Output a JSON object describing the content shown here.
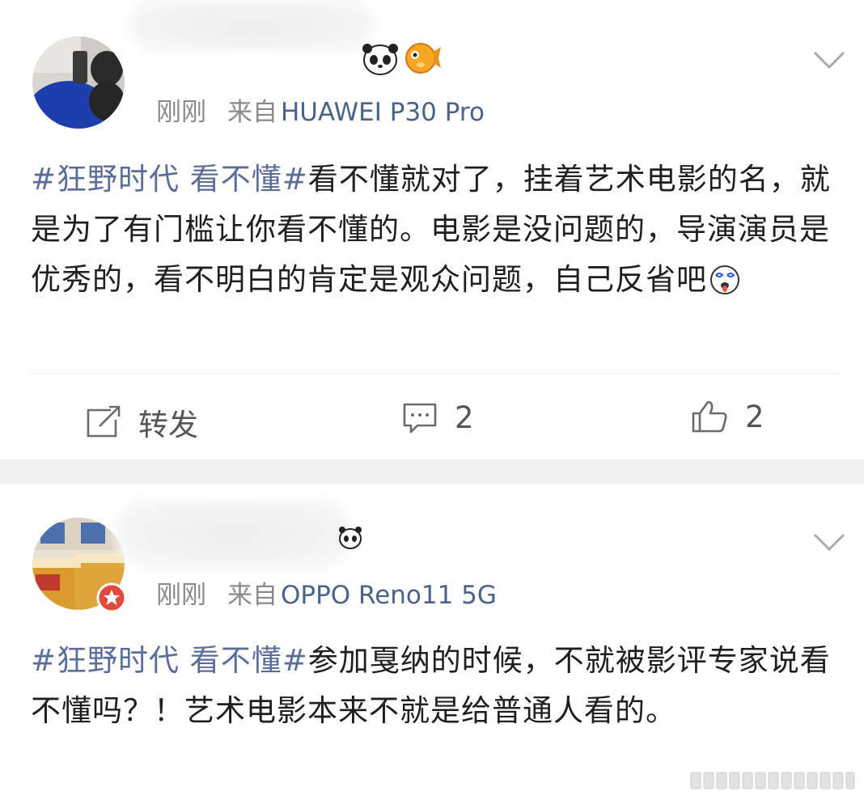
{
  "posts": [
    {
      "time": "刚刚",
      "from_label": "来自",
      "device": "HUAWEI P30 Pro",
      "topic": "#狂野时代 看不懂#",
      "text": "看不懂就对了，挂着艺术电影的名，就是为了有门槛让你看不懂的。电影是没问题的，导演演员是优秀的，看不明白的肯定是观众问题，自己反省吧",
      "emoji_icons": [
        "panda-emoji-icon",
        "pufferfish-emoji-icon"
      ],
      "inline_emoji": "dizzy-face-emoji-icon",
      "actions": {
        "repost_label": "转发",
        "comment_count": "2",
        "like_count": "2"
      }
    },
    {
      "time": "刚刚",
      "from_label": "来自",
      "device": "OPPO Reno11 5G",
      "topic": "#狂野时代 看不懂#",
      "text": "参加戛纳的时候，不就被影评专家说看不懂吗？！艺术电影本来不就是给普通人看的。",
      "emoji_icons": [
        "panda-emoji-icon"
      ],
      "badge": "red-verified-badge-icon"
    }
  ],
  "colors": {
    "link_blue": "#5b6e9a",
    "device_blue": "#4b6389",
    "meta_gray": "#8a8a8a",
    "separator": "#f1f1f1"
  }
}
